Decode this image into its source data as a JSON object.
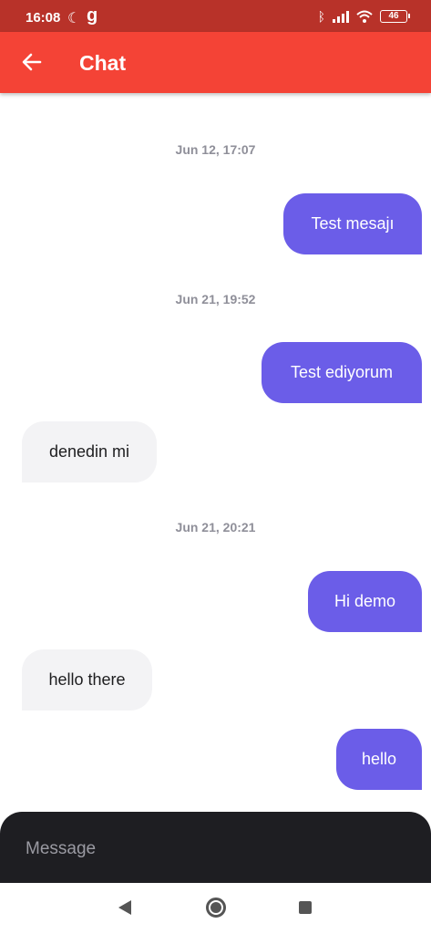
{
  "status_bar": {
    "time": "16:08",
    "battery": "46",
    "icons": [
      "moon-icon",
      "g-app-icon",
      "bluetooth-icon",
      "signal-icon",
      "wifi-icon",
      "battery-icon"
    ]
  },
  "app_bar": {
    "title": "Chat",
    "back_icon": "arrow-left-icon",
    "color": "#f44336"
  },
  "messages": [
    {
      "date": "Jun 12, 17:07"
    },
    {
      "text": "Test mesajı",
      "direction": "outgoing"
    },
    {
      "date": "Jun 21, 19:52"
    },
    {
      "text": "Test ediyorum",
      "direction": "outgoing"
    },
    {
      "text": "denedin mi",
      "direction": "incoming"
    },
    {
      "date": "Jun 21, 20:21"
    },
    {
      "text": "Hi demo",
      "direction": "outgoing"
    },
    {
      "text": "hello there",
      "direction": "incoming"
    },
    {
      "text": "hello",
      "direction": "outgoing"
    }
  ],
  "composer": {
    "placeholder": "Message"
  },
  "colors": {
    "outgoing_bubble": "#6b5de8",
    "incoming_bubble": "#f3f3f5",
    "status_bar": "#b83229",
    "composer": "#1e1e22"
  },
  "nav_bar": {
    "icons": [
      "nav-back-icon",
      "nav-home-icon",
      "nav-recents-icon"
    ]
  }
}
